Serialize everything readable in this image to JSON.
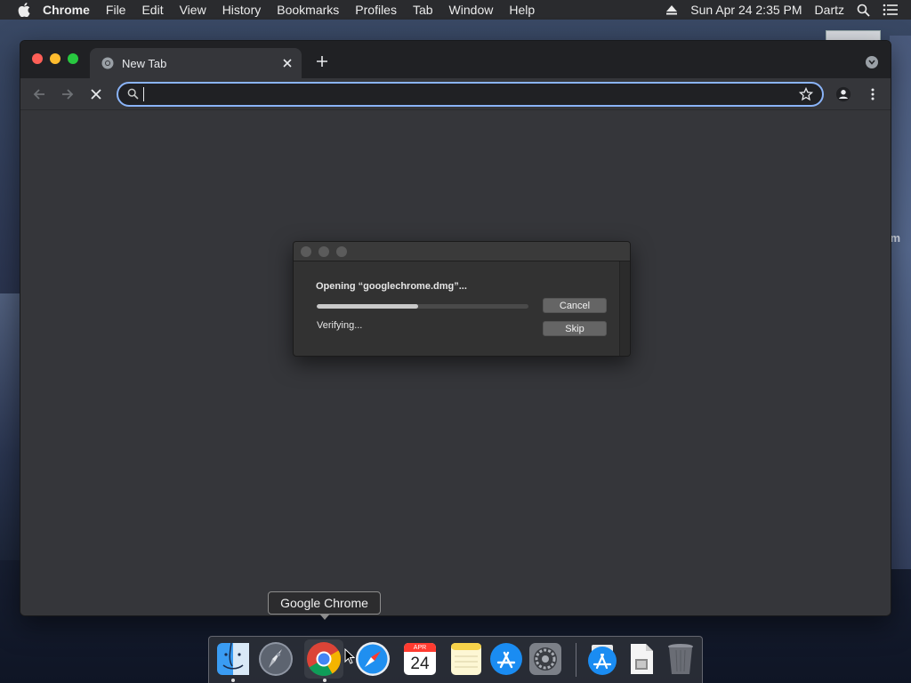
{
  "menubar": {
    "app_name": "Chrome",
    "items": [
      "File",
      "Edit",
      "View",
      "History",
      "Bookmarks",
      "Profiles",
      "Tab",
      "Window",
      "Help"
    ],
    "datetime": "Sun Apr 24  2:35 PM",
    "user": "Dartz"
  },
  "desktop": {
    "edge_text": "m"
  },
  "browser": {
    "tab_title": "New Tab",
    "omnibox_value": ""
  },
  "dialog": {
    "message": "Opening “googlechrome.dmg”...",
    "status": "Verifying...",
    "progress_fraction": 0.48,
    "cancel_label": "Cancel",
    "skip_label": "Skip"
  },
  "dock": {
    "tooltip": "Google Chrome",
    "calendar_month": "APR",
    "calendar_day": "24",
    "items": [
      "finder-icon",
      "launchpad-icon",
      "chrome-icon",
      "safari-icon",
      "calendar-icon",
      "notes-icon",
      "app-store-icon",
      "system-preferences-icon",
      "downloads-stack-icon",
      "document-stack-icon",
      "trash-icon"
    ]
  }
}
